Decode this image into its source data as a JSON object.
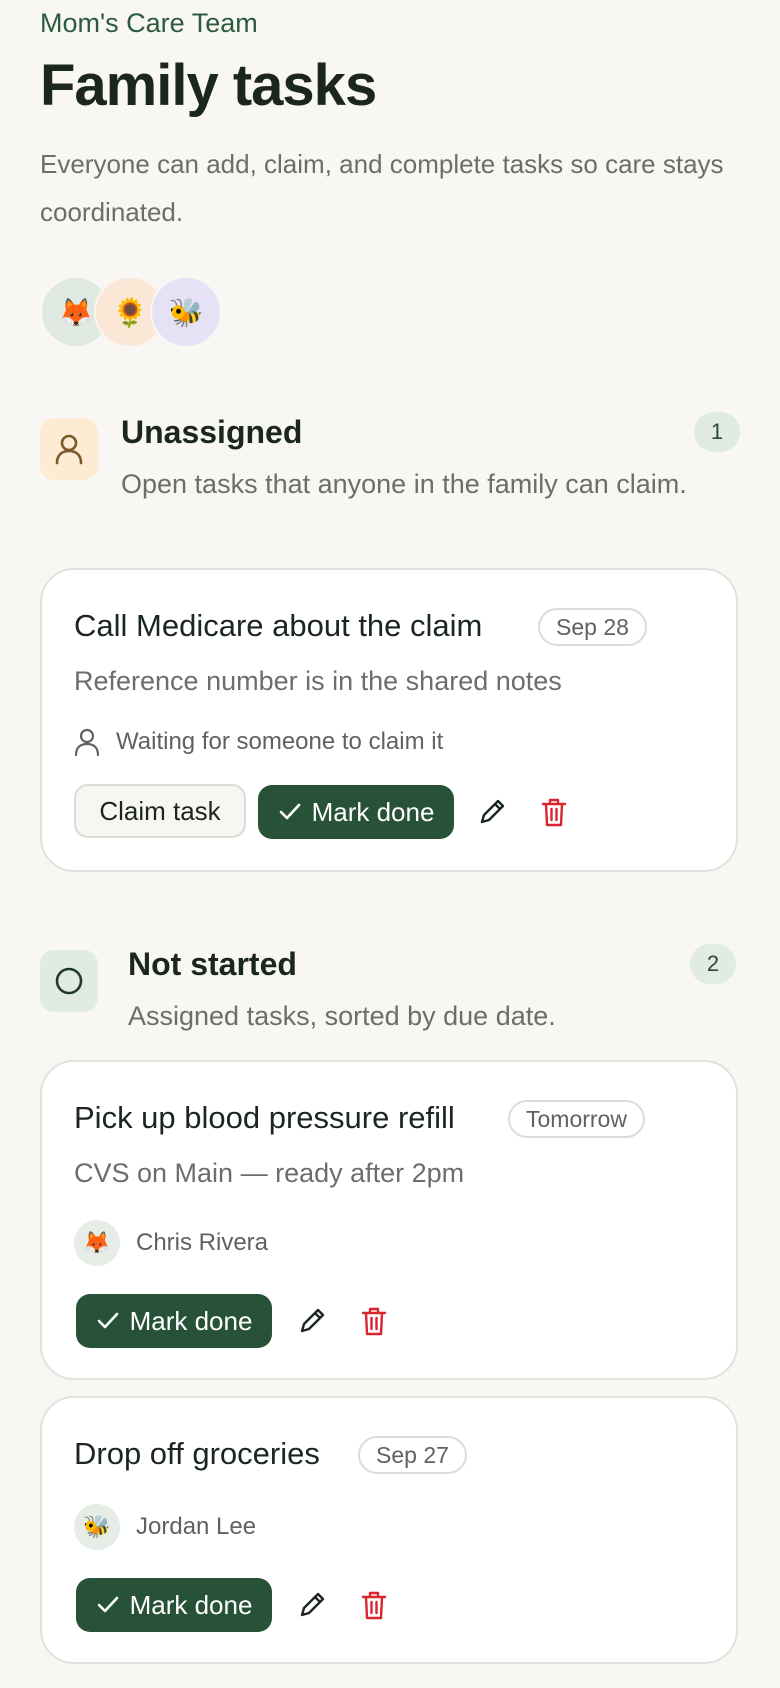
{
  "header": {
    "team_name": "Mom's Care Team",
    "title": "Family tasks",
    "subtitle": "Everyone can add, claim, and complete tasks so care stays coordinated."
  },
  "members": [
    {
      "emoji": "🦊",
      "bg": "#dfe9e1"
    },
    {
      "emoji": "🌻",
      "bg": "#fbe7d6"
    },
    {
      "emoji": "🐝",
      "bg": "#e6e2f6"
    }
  ],
  "sections": [
    {
      "title": "Unassigned",
      "description": "Open tasks that anyone in the family can claim.",
      "count": "1",
      "icon": "person-icon",
      "icon_bg": "#fdebd3",
      "tasks": [
        {
          "title": "Call Medicare about the claim",
          "due": "Sep 28",
          "note": "Reference number is in the shared notes",
          "status": "Waiting for someone to claim it",
          "claim_label": "Claim task",
          "done_label": "Mark done"
        }
      ]
    },
    {
      "title": "Not started",
      "description": "Assigned tasks, sorted by due date.",
      "count": "2",
      "icon": "circle-icon",
      "icon_bg": "#e0ece2",
      "tasks": [
        {
          "title": "Pick up blood pressure refill",
          "due": "Tomorrow",
          "note": "CVS on Main — ready after 2pm",
          "assignee": "Chris Rivera",
          "assignee_emoji": "🦊",
          "done_label": "Mark done"
        },
        {
          "title": "Drop off groceries",
          "due": "Sep 27",
          "assignee": "Jordan Lee",
          "assignee_emoji": "🐝",
          "done_label": "Mark done"
        }
      ]
    }
  ],
  "colors": {
    "accent": "#285238",
    "delete": "#d7262e",
    "background": "#f8f7f3"
  }
}
